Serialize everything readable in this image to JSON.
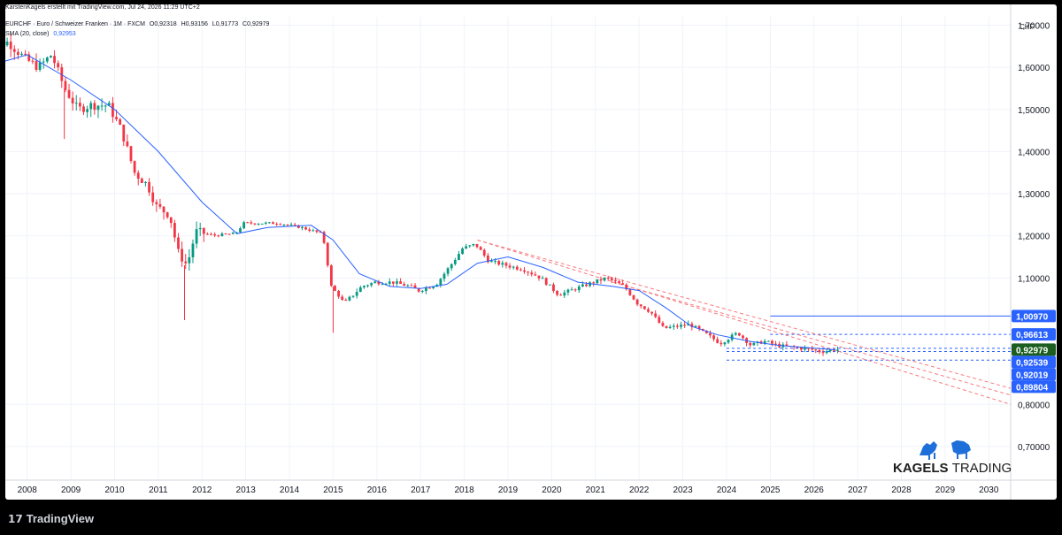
{
  "header": {
    "credit": "KarstenKagels erstellt mit TradingView.com, Jul 24, 2026 11:29 UTC+2",
    "symbol": "EURCHF · Euro / Schweizer Franken · 1M · FXCM",
    "open": "O0,92318",
    "high": "H0,93156",
    "low": "L0,91773",
    "close": "C0,92979",
    "sma_label": "SMA (20, close)",
    "sma_value": "0,92953"
  },
  "footer": {
    "brand": "TradingView"
  },
  "logo": {
    "word1": "KAGELS",
    "word2": "TRADING"
  },
  "colors": {
    "up": "#26a69a",
    "up_candle": "#089981",
    "down": "#f23645",
    "sma": "#2962ff",
    "trend": "#f77c80",
    "level": "#2962ff",
    "last_price": "#1b5e20"
  },
  "chart_data": {
    "type": "candlestick",
    "x_ticks": [
      "2008",
      "2009",
      "2010",
      "2011",
      "2012",
      "2013",
      "2014",
      "2015",
      "2016",
      "2017",
      "2018",
      "2019",
      "2020",
      "2021",
      "2022",
      "2023",
      "2024",
      "2025",
      "2026",
      "2027",
      "2028",
      "2029",
      "2030"
    ],
    "y_unit": "CHF",
    "y_ticks": [
      "1,70000",
      "1,60000",
      "1,50000",
      "1,40000",
      "1,30000",
      "1,20000",
      "1,10000",
      "0,80000",
      "0,70000"
    ],
    "ylim": [
      0.62,
      1.72
    ],
    "xlim": [
      2007.5,
      2030.5
    ],
    "price_labels": [
      {
        "text": "1,00970",
        "value": 1.0097,
        "style": "level"
      },
      {
        "text": "0,96613",
        "value": 0.96613,
        "style": "level"
      },
      {
        "text": "0,92979",
        "value": 0.92979,
        "style": "last"
      },
      {
        "text": "0,92539",
        "value": 0.92539,
        "style": "level"
      },
      {
        "text": "0,92019",
        "value": 0.92019,
        "style": "level"
      },
      {
        "text": "0,89804",
        "value": 0.89804,
        "style": "level"
      }
    ],
    "horizontal_levels": [
      {
        "value": 1.0097,
        "from": 2025.0,
        "dashed": false
      },
      {
        "value": 0.96613,
        "from": 2025.0,
        "dashed": true
      },
      {
        "value": 0.933,
        "from": 2024.0,
        "dashed": true
      },
      {
        "value": 0.92539,
        "from": 2024.0,
        "dashed": true
      },
      {
        "value": 0.905,
        "from": 2024.0,
        "dashed": true
      }
    ],
    "trendlines": [
      {
        "x1": 2018.3,
        "y1": 1.19,
        "x2": 2030.5,
        "y2": 0.838
      },
      {
        "x1": 2018.3,
        "y1": 1.19,
        "x2": 2030.5,
        "y2": 0.8
      },
      {
        "x1": 2021.4,
        "y1": 1.09,
        "x2": 2030.5,
        "y2": 0.822
      }
    ],
    "price_path": [
      [
        2007.0,
        1.65
      ],
      [
        2007.6,
        1.66
      ],
      [
        2008.0,
        1.62
      ],
      [
        2008.3,
        1.6
      ],
      [
        2008.6,
        1.63
      ],
      [
        2008.9,
        1.55
      ],
      [
        2009.2,
        1.5
      ],
      [
        2009.5,
        1.51
      ],
      [
        2009.9,
        1.51
      ],
      [
        2010.2,
        1.45
      ],
      [
        2010.5,
        1.35
      ],
      [
        2010.8,
        1.32
      ],
      [
        2011.0,
        1.27
      ],
      [
        2011.3,
        1.25
      ],
      [
        2011.5,
        1.16
      ],
      [
        2011.7,
        1.13
      ],
      [
        2011.9,
        1.21
      ],
      [
        2012.3,
        1.201
      ],
      [
        2012.8,
        1.205
      ],
      [
        2013.0,
        1.23
      ],
      [
        2013.4,
        1.23
      ],
      [
        2013.8,
        1.23
      ],
      [
        2014.3,
        1.22
      ],
      [
        2014.8,
        1.205
      ],
      [
        2015.0,
        1.08
      ],
      [
        2015.3,
        1.04
      ],
      [
        2015.7,
        1.08
      ],
      [
        2016.0,
        1.09
      ],
      [
        2016.4,
        1.09
      ],
      [
        2016.8,
        1.08
      ],
      [
        2017.0,
        1.07
      ],
      [
        2017.4,
        1.085
      ],
      [
        2017.8,
        1.14
      ],
      [
        2018.0,
        1.17
      ],
      [
        2018.3,
        1.18
      ],
      [
        2018.6,
        1.14
      ],
      [
        2019.0,
        1.13
      ],
      [
        2019.4,
        1.12
      ],
      [
        2019.8,
        1.1
      ],
      [
        2020.2,
        1.06
      ],
      [
        2020.6,
        1.075
      ],
      [
        2021.0,
        1.09
      ],
      [
        2021.3,
        1.1
      ],
      [
        2021.7,
        1.08
      ],
      [
        2022.0,
        1.04
      ],
      [
        2022.3,
        1.02
      ],
      [
        2022.6,
        0.98
      ],
      [
        2022.9,
        0.985
      ],
      [
        2023.2,
        0.99
      ],
      [
        2023.6,
        0.965
      ],
      [
        2023.9,
        0.945
      ],
      [
        2024.3,
        0.97
      ],
      [
        2024.6,
        0.94
      ],
      [
        2024.9,
        0.95
      ],
      [
        2025.2,
        0.94
      ],
      [
        2025.6,
        0.935
      ],
      [
        2026.0,
        0.93
      ],
      [
        2026.2,
        0.925
      ],
      [
        2026.5,
        0.93
      ]
    ],
    "sma_path": [
      [
        2007.0,
        1.6
      ],
      [
        2008.0,
        1.63
      ],
      [
        2009.0,
        1.57
      ],
      [
        2010.0,
        1.5
      ],
      [
        2011.0,
        1.4
      ],
      [
        2012.0,
        1.28
      ],
      [
        2012.8,
        1.205
      ],
      [
        2013.5,
        1.22
      ],
      [
        2014.5,
        1.225
      ],
      [
        2015.0,
        1.19
      ],
      [
        2015.6,
        1.11
      ],
      [
        2016.3,
        1.08
      ],
      [
        2017.0,
        1.075
      ],
      [
        2017.6,
        1.085
      ],
      [
        2018.3,
        1.135
      ],
      [
        2019.0,
        1.15
      ],
      [
        2019.8,
        1.125
      ],
      [
        2020.6,
        1.09
      ],
      [
        2021.4,
        1.08
      ],
      [
        2022.0,
        1.07
      ],
      [
        2022.6,
        1.03
      ],
      [
        2023.2,
        0.985
      ],
      [
        2023.8,
        0.965
      ],
      [
        2024.5,
        0.95
      ],
      [
        2025.2,
        0.94
      ],
      [
        2026.5,
        0.9295
      ]
    ]
  }
}
